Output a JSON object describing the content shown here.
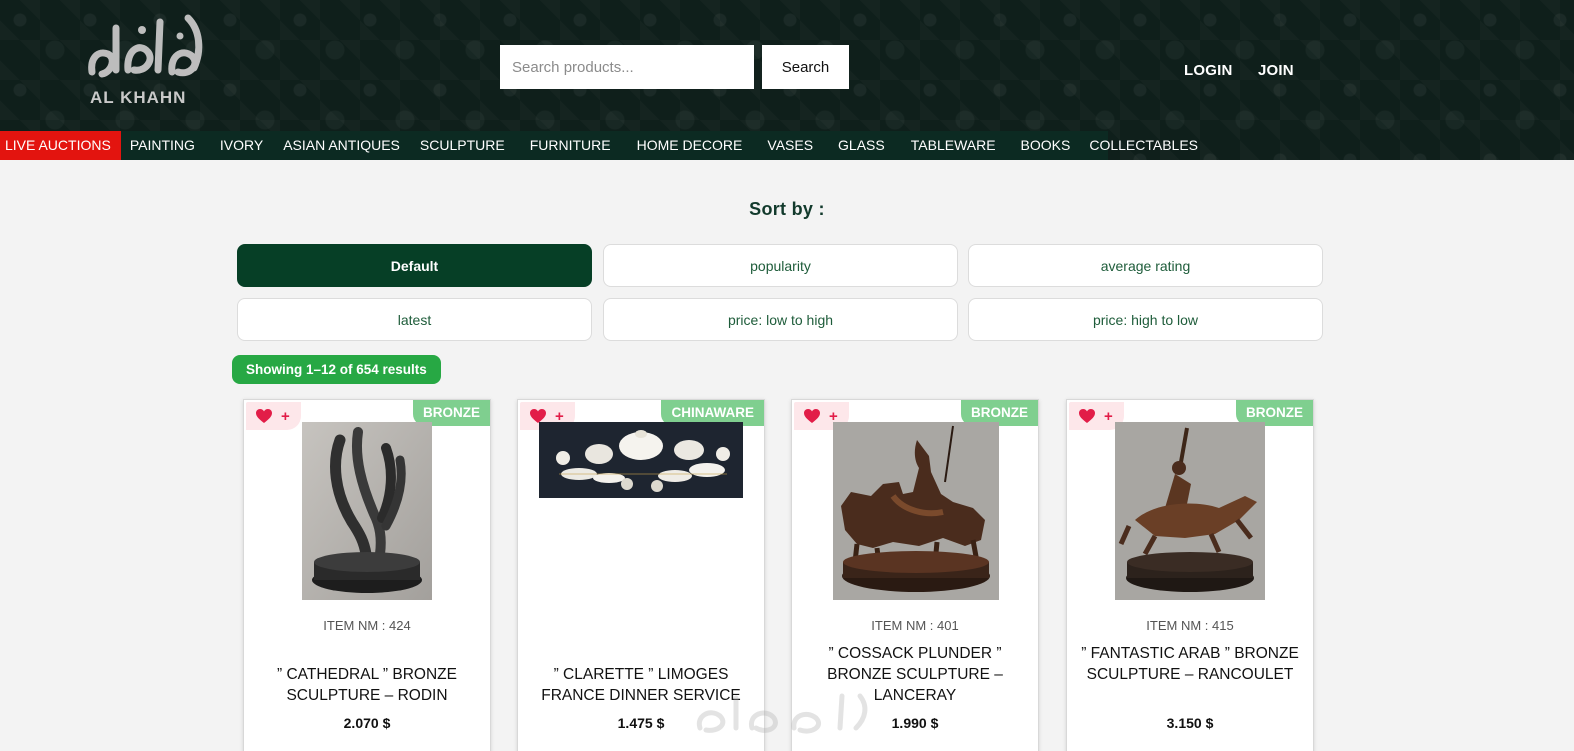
{
  "brand": {
    "logo_text": "AL KHAHN",
    "colors": {
      "header_bg": "#0f1f1b",
      "nav_bg": "#0c2a22",
      "live": "#e3140f",
      "accent": "#063f26",
      "badge": "#7fcf8f",
      "results": "#27a844"
    }
  },
  "search": {
    "placeholder": "Search products...",
    "button_label": "Search"
  },
  "auth": {
    "login_label": "LOGIN",
    "join_label": "JOIN"
  },
  "nav": {
    "live_label": "LIVE AUCTIONS",
    "items": [
      "PAINTING",
      "IVORY",
      "ASIAN ANTIQUES",
      "SCULPTURE",
      "FURNITURE",
      "HOME DECORE",
      "VASES",
      "GLASS",
      "TABLEWARE",
      "BOOKS",
      "COLLECTABLES"
    ]
  },
  "sort": {
    "title": "Sort by :",
    "options": [
      "Default",
      "popularity",
      "average rating",
      "latest",
      "price: low to high",
      "price: high to low"
    ],
    "active": "Default"
  },
  "results_text": "Showing 1–12 of 654 results",
  "products": [
    {
      "badge": "BRONZE",
      "item_nm": "ITEM NM : 424",
      "title": "” CATHEDRAL ” BRONZE SCULPTURE – RODIN",
      "price": "2.070 $",
      "icons": [
        "heart-icon",
        "plus-icon"
      ]
    },
    {
      "badge": "CHINAWARE",
      "item_nm": "",
      "title": "” CLARETTE ” LIMOGES FRANCE DINNER SERVICE",
      "price": "1.475 $",
      "icons": [
        "heart-icon",
        "plus-icon"
      ]
    },
    {
      "badge": "BRONZE",
      "item_nm": "ITEM NM : 401",
      "title": "” COSSACK PLUNDER ” BRONZE SCULPTURE – LANCERAY",
      "price": "1.990 $",
      "icons": [
        "heart-icon",
        "plus-icon"
      ]
    },
    {
      "badge": "BRONZE",
      "item_nm": "ITEM NM : 415",
      "title": "” FANTASTIC ARAB ” BRONZE SCULPTURE – RANCOULET",
      "price": "3.150 $",
      "icons": [
        "heart-icon",
        "plus-icon"
      ]
    }
  ]
}
